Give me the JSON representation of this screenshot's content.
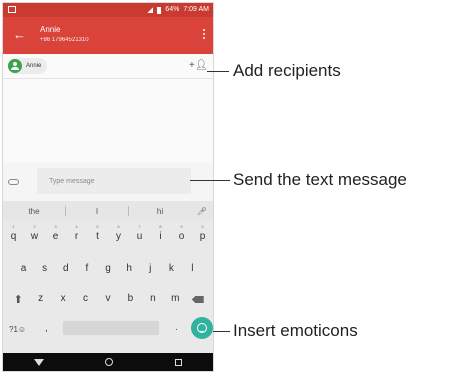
{
  "status_bar": {
    "battery": "64%",
    "time": "7:09 AM"
  },
  "header": {
    "back": "←",
    "name": "Annie",
    "number": "+86 17964521310"
  },
  "recipient": {
    "chip_label": "Annie",
    "add_icon": "add-person-icon"
  },
  "compose": {
    "placeholder": "Type message"
  },
  "keyboard": {
    "suggestions": [
      "the",
      "I",
      "hi"
    ],
    "row1": [
      {
        "key": "q",
        "hint": "1"
      },
      {
        "key": "w",
        "hint": "2"
      },
      {
        "key": "e",
        "hint": "3"
      },
      {
        "key": "r",
        "hint": "4"
      },
      {
        "key": "t",
        "hint": "5"
      },
      {
        "key": "y",
        "hint": "6"
      },
      {
        "key": "u",
        "hint": "7"
      },
      {
        "key": "i",
        "hint": "8"
      },
      {
        "key": "o",
        "hint": "9"
      },
      {
        "key": "p",
        "hint": "0"
      }
    ],
    "row2": [
      "a",
      "s",
      "d",
      "f",
      "g",
      "h",
      "j",
      "k",
      "l"
    ],
    "row3": [
      "z",
      "x",
      "c",
      "v",
      "b",
      "n",
      "m"
    ],
    "symbols": "?1☺",
    "comma": ",",
    "period": "."
  },
  "callouts": {
    "add_recipients": "Add recipients",
    "send_text": "Send the text message",
    "insert_emoticons": "Insert emoticons"
  }
}
